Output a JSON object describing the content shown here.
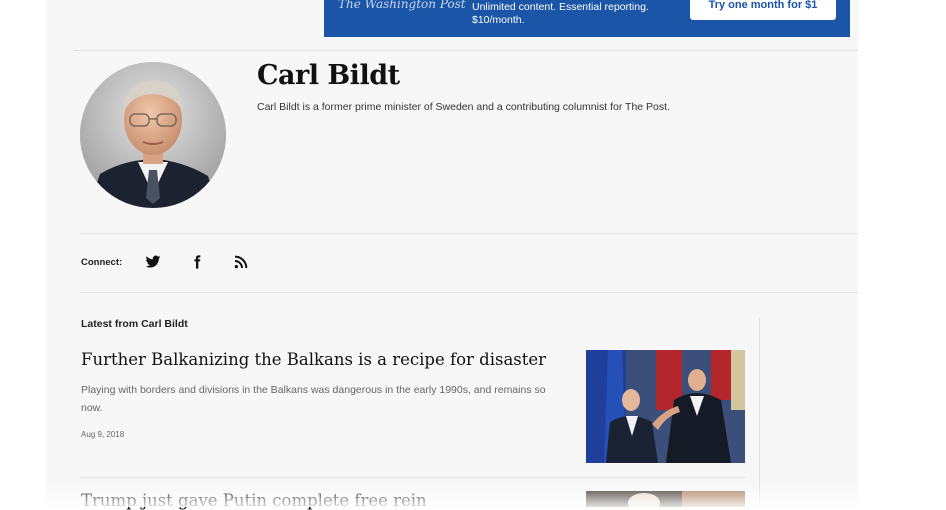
{
  "banner": {
    "logo": "The Washington Post",
    "offer_line1": "Unlimited content. Essential reporting.",
    "offer_line2": "$10/month.",
    "cta": "Try one month for $1"
  },
  "profile": {
    "name": "Carl Bildt",
    "bio": "Carl Bildt is a former prime minister of Sweden and a contributing columnist for The Post."
  },
  "connect": {
    "label": "Connect:",
    "icons": [
      "twitter-icon",
      "facebook-icon",
      "rss-icon"
    ]
  },
  "latest": {
    "label": "Latest from Carl Bildt",
    "articles": [
      {
        "title": "Further Balkanizing the Balkans is a recipe for disaster",
        "blurb": "Playing with borders and divisions in the Balkans was dangerous in the early 1990s, and remains so now.",
        "date": "Aug 9, 2018"
      },
      {
        "title": "Trump just gave Putin complete free rein"
      }
    ]
  },
  "colors": {
    "banner_blue": "#1a55a8",
    "page_bg": "#f7f7f7",
    "rule": "#e2e2e2"
  }
}
